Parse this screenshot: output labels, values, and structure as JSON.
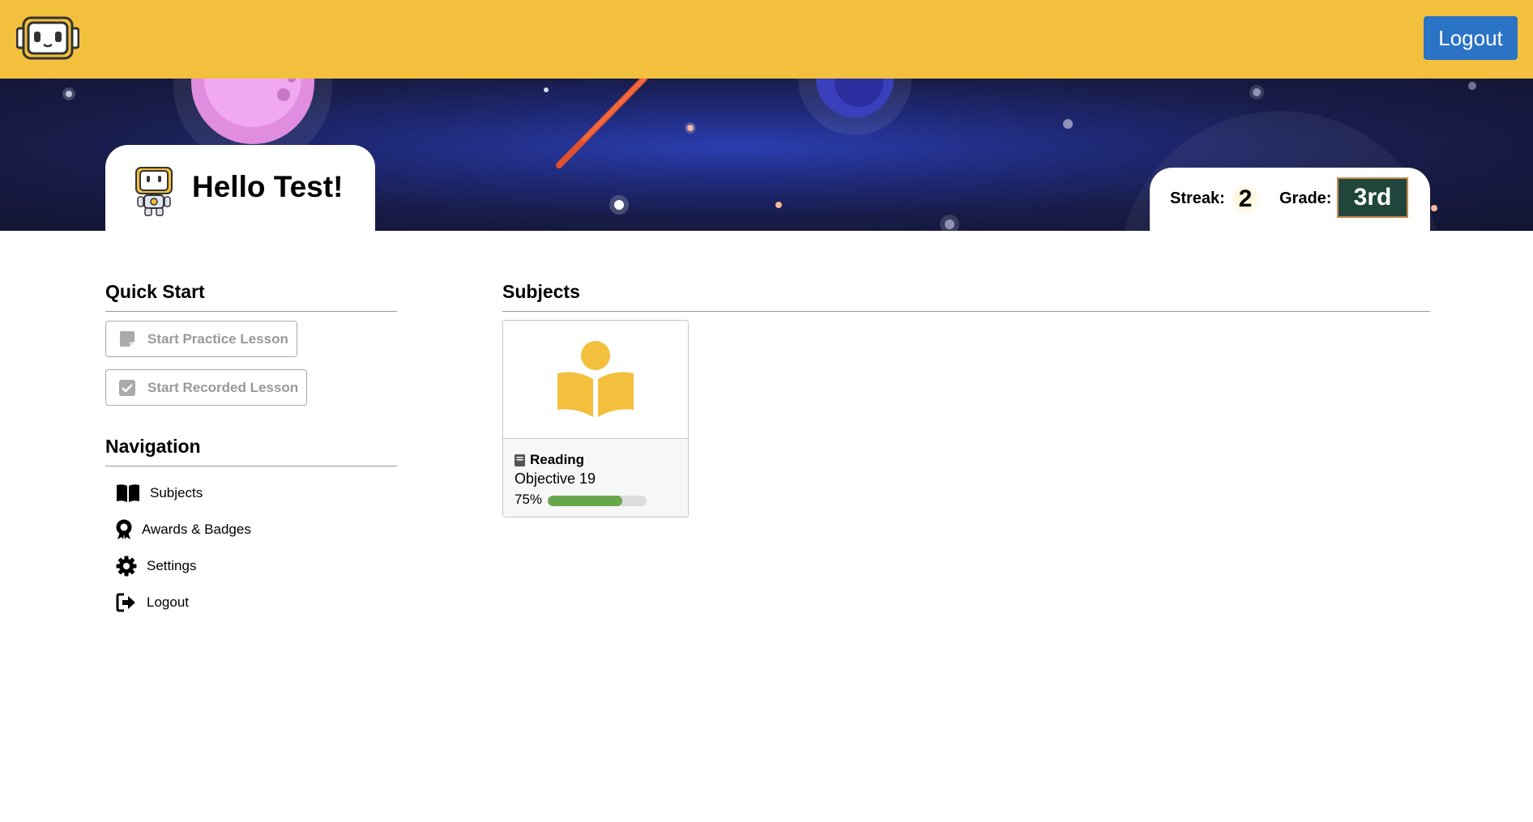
{
  "header": {
    "logout_label": "Logout"
  },
  "greeting": {
    "text": "Hello Test!"
  },
  "stats": {
    "streak_label": "Streak:",
    "streak_value": "2",
    "grade_label": "Grade:",
    "grade_value": "3rd"
  },
  "quick_start": {
    "title": "Quick Start",
    "practice_label": "Start Practice Lesson",
    "recorded_label": "Start Recorded Lesson"
  },
  "navigation": {
    "title": "Navigation",
    "items": [
      {
        "label": "Subjects",
        "icon": "book-open-icon"
      },
      {
        "label": "Awards & Badges",
        "icon": "award-icon"
      },
      {
        "label": "Settings",
        "icon": "gear-icon"
      },
      {
        "label": "Logout",
        "icon": "sign-out-icon"
      }
    ]
  },
  "subjects": {
    "title": "Subjects",
    "cards": [
      {
        "name": "Reading",
        "objective": "Objective 19",
        "progress_label": "75%",
        "progress": 0.75,
        "icon": "reading-icon"
      }
    ]
  },
  "colors": {
    "header": "#f2c03c",
    "logout_button": "#2a73c5",
    "grade_badge": "#20463c",
    "progress": "#67a64a",
    "subject_icon": "#f2c03c"
  }
}
